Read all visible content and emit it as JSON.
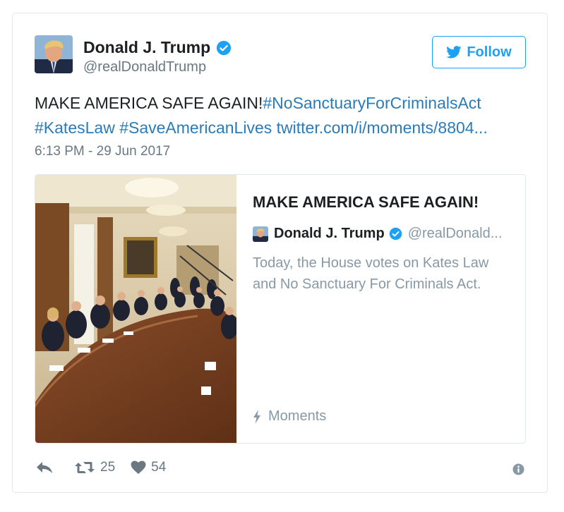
{
  "tweet": {
    "author_name": "Donald J. Trump",
    "author_handle": "@realDonaldTrump",
    "follow_label": "Follow",
    "text_plain": "MAKE AMERICA SAFE AGAIN!",
    "hashtag_1": "#NoSanctuaryForCriminalsAct",
    "hashtag_2": "#KatesLaw",
    "hashtag_3": "#SaveAmericanLives",
    "link": "twitter.com/i/moments/8804...",
    "timestamp": "6:13 PM - 29 Jun 2017"
  },
  "embed": {
    "title": "MAKE AMERICA SAFE AGAIN!",
    "author_name": "Donald J. Trump",
    "author_handle": "@realDonald...",
    "description": "Today, the House votes on Kates Law and No Sanctuary For Criminals Act.",
    "moments_label": "Moments"
  },
  "actions": {
    "retweet_count": "25",
    "like_count": "54"
  },
  "colors": {
    "link_blue": "#2b7bb9",
    "twitter_blue": "#1da1f2",
    "muted_gray": "#697882"
  },
  "icons": [
    "verified-badge-icon",
    "twitter-bird-icon",
    "reply-icon",
    "retweet-icon",
    "heart-icon",
    "info-icon",
    "lightning-icon"
  ]
}
